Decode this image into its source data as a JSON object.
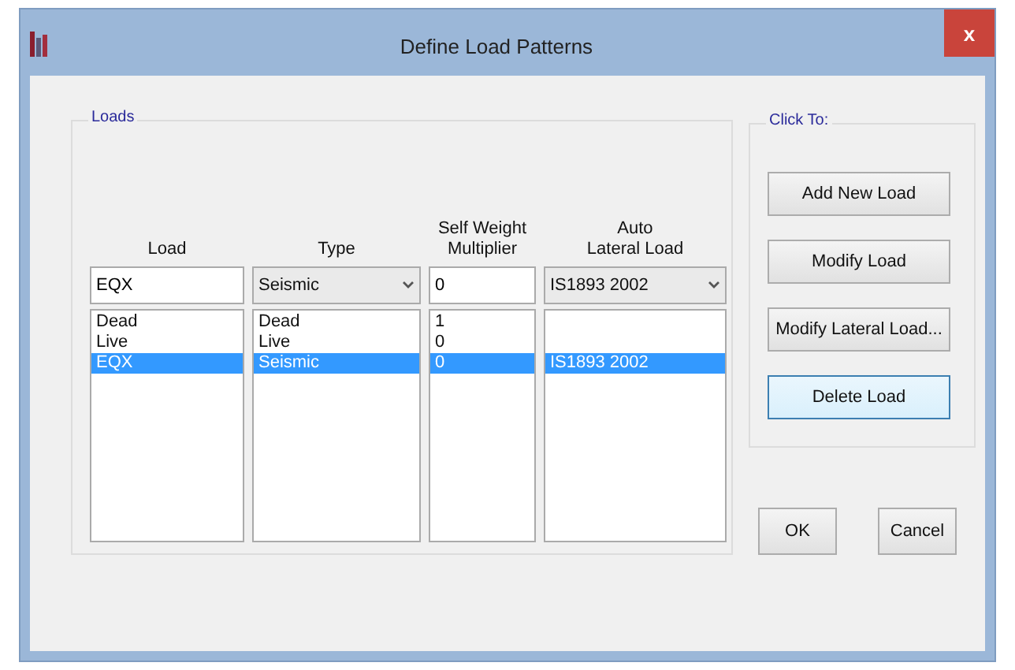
{
  "window": {
    "title": "Define Load Patterns",
    "close": "x"
  },
  "loads": {
    "label": "Loads",
    "columns": [
      {
        "lines": [
          "Load"
        ]
      },
      {
        "lines": [
          "Type"
        ]
      },
      {
        "lines": [
          "Self Weight",
          "Multiplier"
        ]
      },
      {
        "lines": [
          "Auto",
          "Lateral Load"
        ]
      }
    ],
    "entry": {
      "load": "EQX",
      "type": "Seismic",
      "multiplier": "0",
      "auto_lateral": "IS1893 2002"
    },
    "rows": [
      {
        "load": "Dead",
        "type": "Dead",
        "multiplier": "1",
        "selected": false
      },
      {
        "load": "Live",
        "type": "Live",
        "multiplier": "0",
        "selected": false
      },
      {
        "load": "EQX",
        "type": "Seismic",
        "multiplier": "0",
        "auto_lateral": "IS1893 2002",
        "selected": true
      }
    ]
  },
  "click_to": {
    "label": "Click To:",
    "buttons": [
      {
        "label": "Add New Load",
        "focused": false
      },
      {
        "label": "Modify Load",
        "focused": false
      },
      {
        "label": "Modify Lateral Load...",
        "focused": false
      },
      {
        "label": "Delete Load",
        "focused": true
      }
    ]
  },
  "buttons": [
    "OK",
    "Cancel"
  ]
}
